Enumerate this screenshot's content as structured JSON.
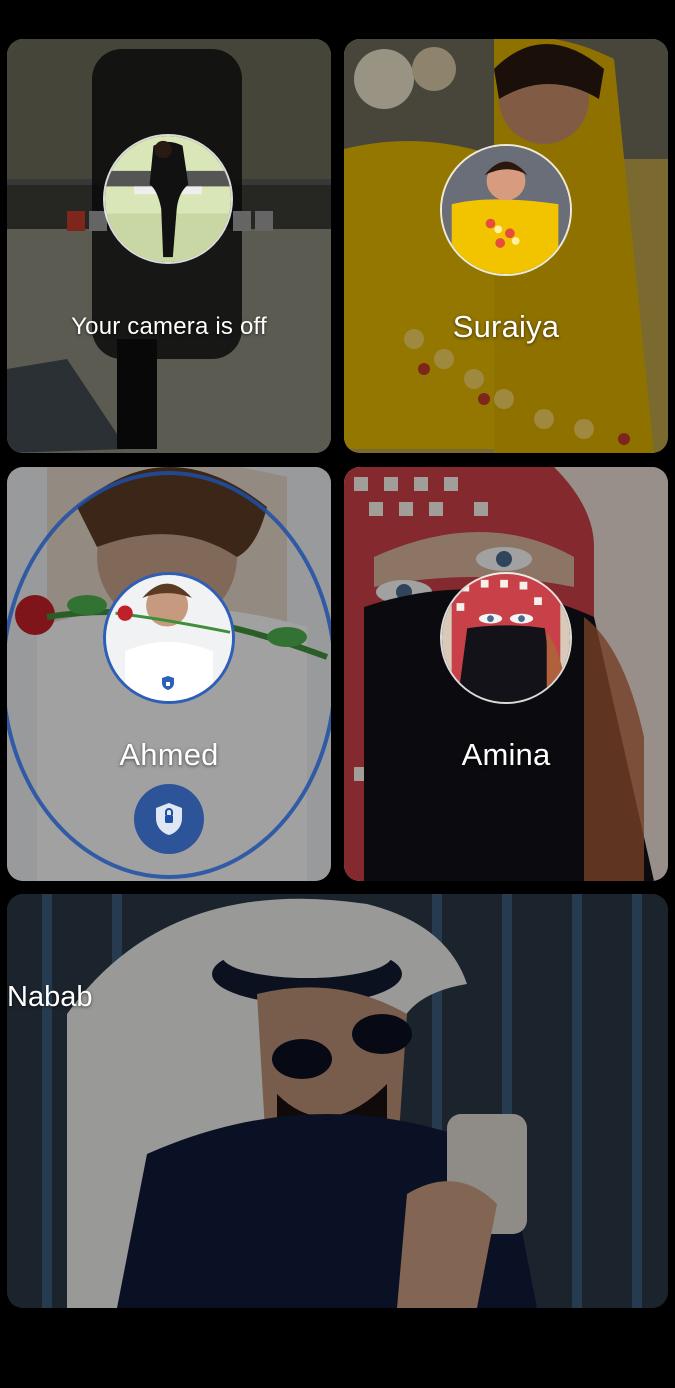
{
  "participants": [
    {
      "id": "self",
      "label": "Your camera is off",
      "avatar_icon": "user-avatar-icon"
    },
    {
      "id": "suraiya",
      "label": "Suraiya",
      "avatar_icon": "user-avatar-icon"
    },
    {
      "id": "ahmed",
      "label": "Ahmed",
      "avatar_icon": "user-avatar-icon",
      "badge_icon": "shield-icon",
      "overlay_icon": "lock-shield-icon"
    },
    {
      "id": "amina",
      "label": "Amina",
      "avatar_icon": "user-avatar-icon"
    },
    {
      "id": "nabab",
      "label": "Nabab"
    }
  ],
  "colors": {
    "background": "#000000",
    "text": "#ffffff",
    "accent_blue": "#1f4fa6"
  }
}
